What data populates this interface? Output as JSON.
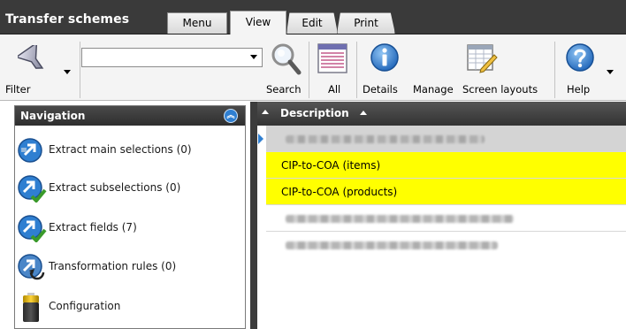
{
  "app": {
    "title": "Transfer schemes"
  },
  "tabs": [
    {
      "label": "Menu",
      "active": false
    },
    {
      "label": "View",
      "active": true
    },
    {
      "label": "Edit",
      "active": false
    },
    {
      "label": "Print",
      "active": false
    }
  ],
  "toolbar": {
    "filter_label": "Filter",
    "search_value": "",
    "search_label": "Search",
    "all_label": "All",
    "details_label": "Details",
    "manage_label": "Manage",
    "screen_layouts_label": "Screen layouts",
    "help_label": "Help",
    "icons": [
      "filter-funnel-icon",
      "search-magnifier-icon",
      "all-records-icon",
      "details-info-icon",
      "screen-layout-icon",
      "help-icon"
    ]
  },
  "navigation": {
    "title": "Navigation",
    "collapse_icon": "double-chevron-up-icon",
    "items": [
      {
        "label": "Extract main selections (0)",
        "icon": "extract-main-icon"
      },
      {
        "label": "Extract subselections (0)",
        "icon": "extract-sub-icon"
      },
      {
        "label": "Extract fields (7)",
        "icon": "extract-fields-icon"
      },
      {
        "label": "Transformation rules (0)",
        "icon": "transformation-rules-icon"
      },
      {
        "label": "Configuration",
        "icon": "battery-config-icon"
      }
    ]
  },
  "grid": {
    "column_header": "Description",
    "rows": [
      {
        "text": "",
        "blurred": true,
        "state": "selected"
      },
      {
        "text": "CIP-to-COA (items)",
        "blurred": false,
        "state": "highlight"
      },
      {
        "text": "CIP-to-COA (products)",
        "blurred": false,
        "state": "highlight"
      },
      {
        "text": "",
        "blurred": true,
        "state": "normal"
      },
      {
        "text": "",
        "blurred": true,
        "state": "normal"
      }
    ]
  },
  "colors": {
    "title_bar": "#3a3a3a",
    "highlight_row": "#ffff00",
    "selected_row": "#d4d4d4",
    "accent_blue": "#2f7fd1"
  }
}
